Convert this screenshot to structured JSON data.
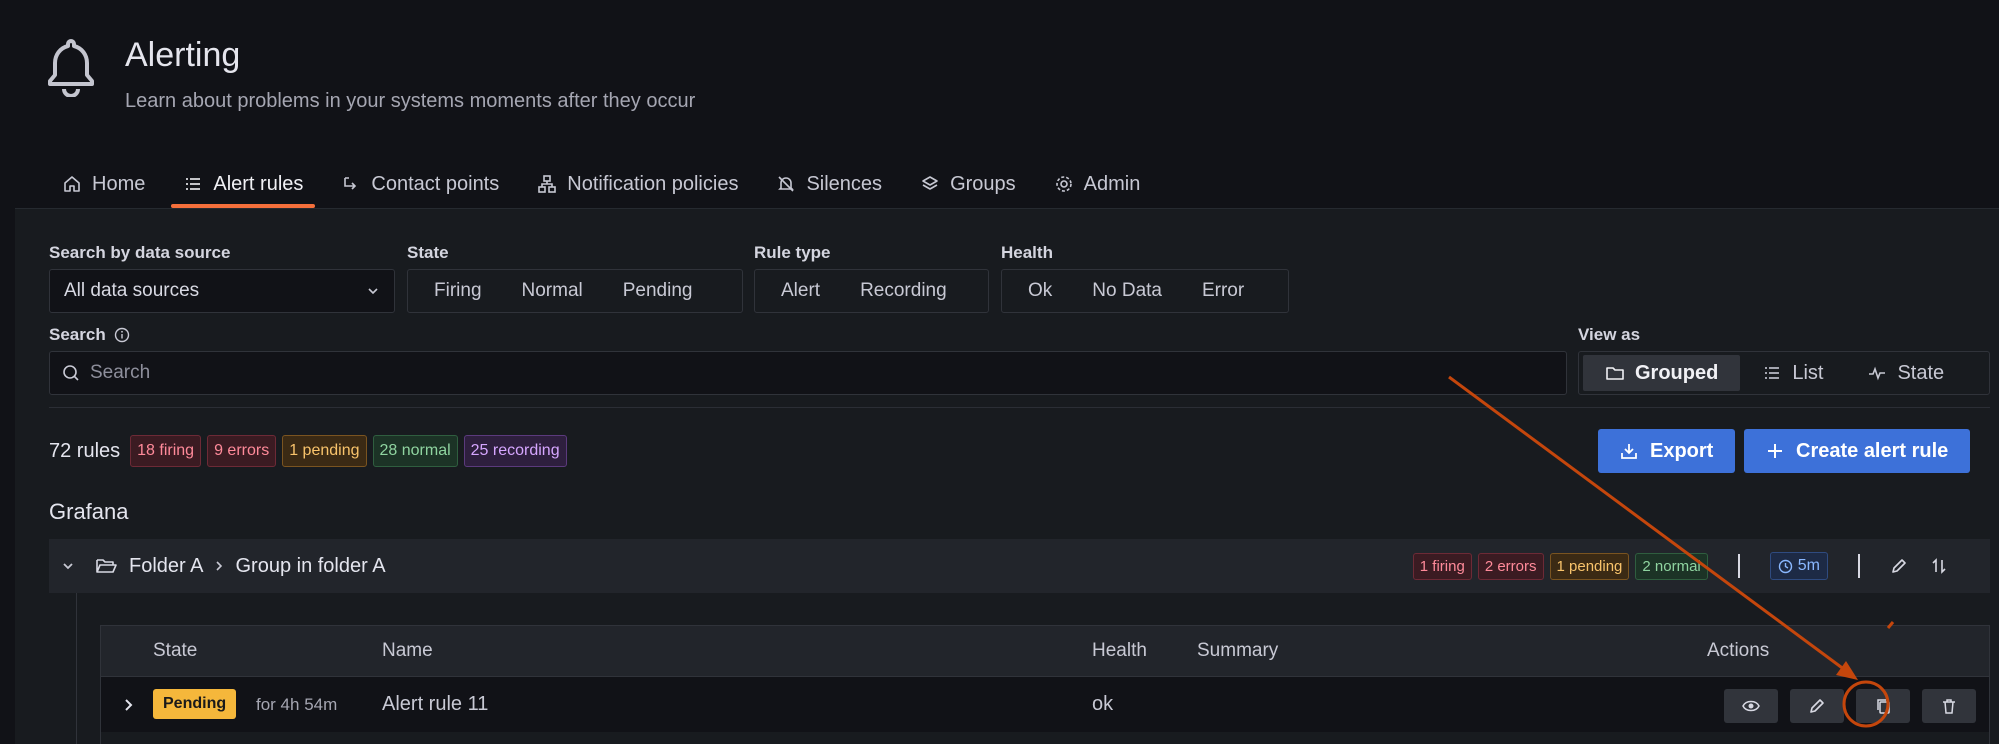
{
  "header": {
    "title": "Alerting",
    "subtitle": "Learn about problems in your systems moments after they occur"
  },
  "tabs": [
    {
      "label": "Home",
      "icon": "home-icon"
    },
    {
      "label": "Alert rules",
      "icon": "list-icon",
      "active": true
    },
    {
      "label": "Contact points",
      "icon": "comment-arrow-icon"
    },
    {
      "label": "Notification policies",
      "icon": "sitemap-icon"
    },
    {
      "label": "Silences",
      "icon": "bell-slash-icon"
    },
    {
      "label": "Groups",
      "icon": "layer-group-icon"
    },
    {
      "label": "Admin",
      "icon": "cog-icon"
    }
  ],
  "filters": {
    "datasource_label": "Search by data source",
    "datasource_value": "All data sources",
    "state_label": "State",
    "state_options": [
      "Firing",
      "Normal",
      "Pending"
    ],
    "ruletype_label": "Rule type",
    "ruletype_options": [
      "Alert",
      "Recording"
    ],
    "health_label": "Health",
    "health_options": [
      "Ok",
      "No Data",
      "Error"
    ],
    "search_label": "Search",
    "search_placeholder": "Search",
    "viewas_label": "View as",
    "viewas_options": [
      "Grouped",
      "List",
      "State"
    ]
  },
  "stats": {
    "count": "72 rules",
    "firing": "18 firing",
    "errors": "9 errors",
    "pending": "1 pending",
    "normal": "28 normal",
    "recording": "25 recording"
  },
  "actions": {
    "export": "Export",
    "create": "Create alert rule"
  },
  "section_title": "Grafana",
  "folder": {
    "name": "Folder A",
    "group": "Group in folder A",
    "firing": "1 firing",
    "errors": "2 errors",
    "pending": "1 pending",
    "normal": "2 normal",
    "interval": "5m"
  },
  "table": {
    "headers": {
      "state": "State",
      "name": "Name",
      "health": "Health",
      "summary": "Summary",
      "actions": "Actions"
    },
    "rows": [
      {
        "state": "Pending",
        "duration": "for 4h 54m",
        "name": "Alert rule 11",
        "health": "ok"
      }
    ]
  },
  "colors": {
    "accent": "#f56f3b",
    "primary": "#3d71d9",
    "annotation": "#c4460c"
  }
}
